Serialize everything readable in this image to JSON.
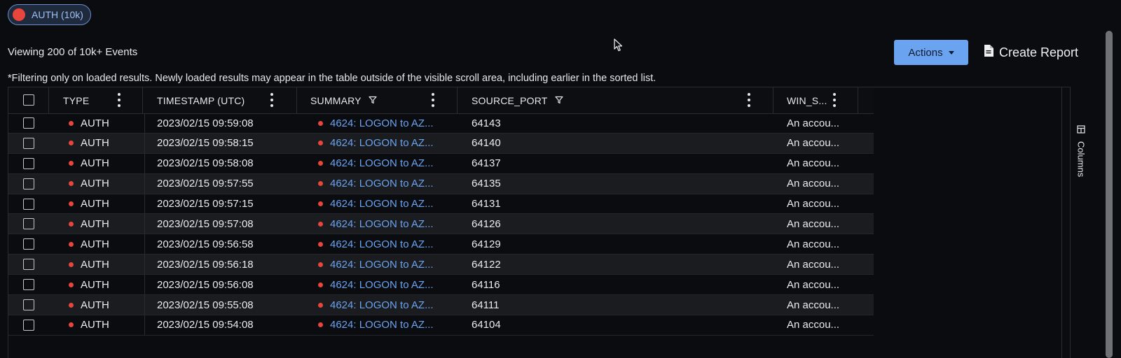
{
  "filter_chip": {
    "label": "AUTH (10k)"
  },
  "viewing_text": "Viewing 200 of 10k+ Events",
  "filter_note": "*Filtering only on loaded results.  Newly loaded results may appear in the table outside of the visible scroll area, including earlier in the sorted list.",
  "actions": {
    "label": "Actions"
  },
  "create_report": {
    "label": "Create Report"
  },
  "columns_tab": {
    "label": "Columns"
  },
  "headers": {
    "type": "TYPE",
    "timestamp": "TIMESTAMP (UTC)",
    "summary": "SUMMARY",
    "source_port": "SOURCE_PORT",
    "win_s": "WIN_S..."
  },
  "rows": [
    {
      "type": "AUTH",
      "timestamp": "2023/02/15 09:59:08",
      "summary": "4624: LOGON to AZ...",
      "source_port": "64143",
      "win_s": "An accou..."
    },
    {
      "type": "AUTH",
      "timestamp": "2023/02/15 09:58:15",
      "summary": "4624: LOGON to AZ...",
      "source_port": "64140",
      "win_s": "An accou..."
    },
    {
      "type": "AUTH",
      "timestamp": "2023/02/15 09:58:08",
      "summary": "4624: LOGON to AZ...",
      "source_port": "64137",
      "win_s": "An accou..."
    },
    {
      "type": "AUTH",
      "timestamp": "2023/02/15 09:57:55",
      "summary": "4624: LOGON to AZ...",
      "source_port": "64135",
      "win_s": "An accou..."
    },
    {
      "type": "AUTH",
      "timestamp": "2023/02/15 09:57:15",
      "summary": "4624: LOGON to AZ...",
      "source_port": "64131",
      "win_s": "An accou..."
    },
    {
      "type": "AUTH",
      "timestamp": "2023/02/15 09:57:08",
      "summary": "4624: LOGON to AZ...",
      "source_port": "64126",
      "win_s": "An accou..."
    },
    {
      "type": "AUTH",
      "timestamp": "2023/02/15 09:56:58",
      "summary": "4624: LOGON to AZ...",
      "source_port": "64129",
      "win_s": "An accou..."
    },
    {
      "type": "AUTH",
      "timestamp": "2023/02/15 09:56:18",
      "summary": "4624: LOGON to AZ...",
      "source_port": "64122",
      "win_s": "An accou..."
    },
    {
      "type": "AUTH",
      "timestamp": "2023/02/15 09:56:08",
      "summary": "4624: LOGON to AZ...",
      "source_port": "64116",
      "win_s": "An accou..."
    },
    {
      "type": "AUTH",
      "timestamp": "2023/02/15 09:55:08",
      "summary": "4624: LOGON to AZ...",
      "source_port": "64111",
      "win_s": "An accou..."
    },
    {
      "type": "AUTH",
      "timestamp": "2023/02/15 09:54:08",
      "summary": "4624: LOGON to AZ...",
      "source_port": "64104",
      "win_s": "An accou..."
    }
  ],
  "colors": {
    "accent": "#6aa3f0",
    "auth_dot": "#e8453c",
    "background": "#0b0c0f"
  }
}
